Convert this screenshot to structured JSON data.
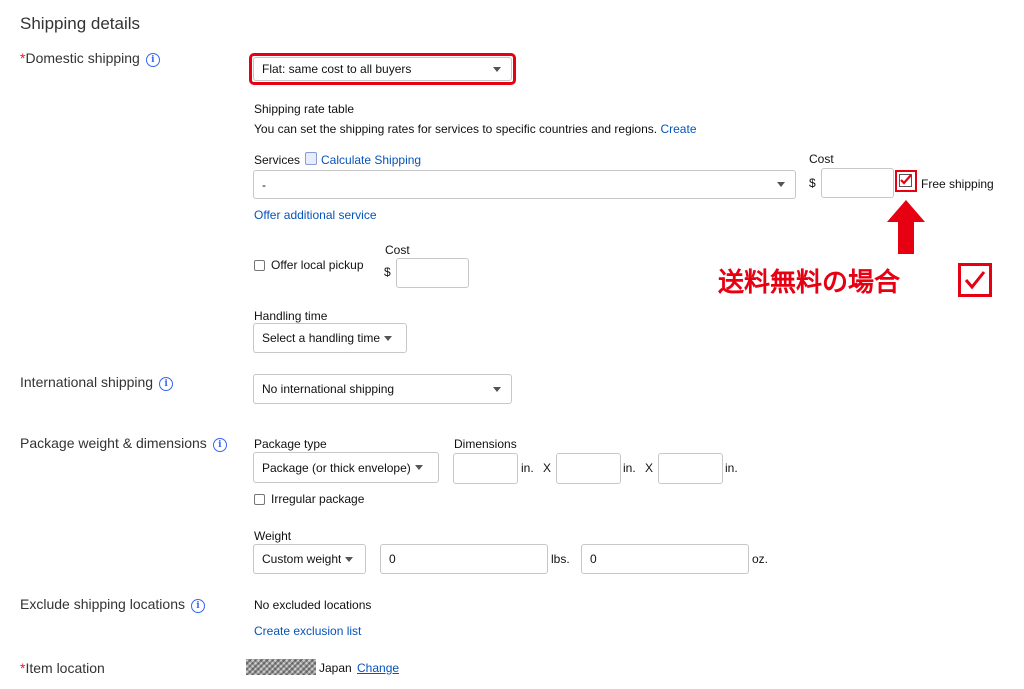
{
  "page": {
    "title": "Shipping details"
  },
  "domestic": {
    "required_mark": "*",
    "label": "Domestic shipping",
    "info_glyph": "i",
    "method_value": "Flat: same cost to all buyers",
    "rate_table_title": "Shipping rate table",
    "rate_table_desc": "You can set the shipping rates for services to specific countries and regions.",
    "rate_table_create_link": "Create",
    "services_label": "Services",
    "calculate_link": "Calculate Shipping",
    "service_value": "-",
    "cost_label": "Cost",
    "currency": "$",
    "cost_value": "",
    "free_shipping_label": "Free shipping",
    "free_shipping_checked": true,
    "offer_additional_link": "Offer additional service",
    "local_pickup_label": "Offer local pickup",
    "local_pickup_checked": false,
    "local_cost_label": "Cost",
    "local_currency": "$",
    "local_cost_value": "",
    "handling_label": "Handling time",
    "handling_value": "Select a handling time"
  },
  "annotation": {
    "note_text": "送料無料の場合",
    "check_glyph": "✓",
    "color": "#e60012"
  },
  "international": {
    "label": "International shipping",
    "info_glyph": "i",
    "value": "No international shipping"
  },
  "package": {
    "label": "Package weight & dimensions",
    "info_glyph": "i",
    "type_label": "Package type",
    "type_value": "Package (or thick envelope)",
    "dimensions_label": "Dimensions",
    "dim_values": [
      "",
      "",
      ""
    ],
    "dim_unit": "in.",
    "dim_separator": "X",
    "irregular_label": "Irregular package",
    "irregular_checked": false,
    "weight_label": "Weight",
    "weight_type_value": "Custom weight",
    "lbs_value": "0",
    "lbs_unit": "lbs.",
    "oz_value": "0",
    "oz_unit": "oz."
  },
  "exclude": {
    "label": "Exclude shipping locations",
    "info_glyph": "i",
    "value": "No excluded locations",
    "create_link": "Create exclusion list"
  },
  "item_location": {
    "required_mark": "*",
    "label": "Item location",
    "country": "Japan",
    "change_link": "Change"
  },
  "colors": {
    "link": "#0654ba",
    "required": "#dd1e31",
    "text": "#333333"
  }
}
